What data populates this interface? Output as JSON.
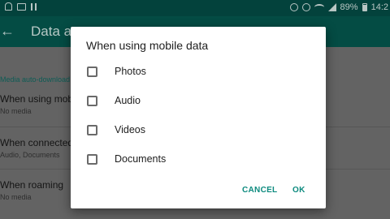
{
  "status_bar": {
    "battery_percent": "89%",
    "time": "14:2",
    "icons_left": [
      "notification-icon",
      "image-icon",
      "pause-icon"
    ],
    "icons_right": [
      "mute-icon",
      "alarm-icon",
      "wifi-icon",
      "signal-icon",
      "battery-icon"
    ]
  },
  "app_bar": {
    "title": "Data ar"
  },
  "background": {
    "section_label": "Media auto-download",
    "settings": [
      {
        "title": "When using mobile",
        "subtitle": "No media"
      },
      {
        "title": "When connected o",
        "subtitle": "Audio, Documents"
      },
      {
        "title": "When roaming",
        "subtitle": "No media"
      }
    ]
  },
  "dialog": {
    "title": "When using mobile data",
    "options": [
      {
        "label": "Photos",
        "checked": false
      },
      {
        "label": "Audio",
        "checked": false
      },
      {
        "label": "Videos",
        "checked": false
      },
      {
        "label": "Documents",
        "checked": false
      }
    ],
    "cancel_label": "CANCEL",
    "ok_label": "OK"
  },
  "colors": {
    "accent": "#0c8a7e",
    "app_bar": "#044c44",
    "status_bar": "#03423c"
  }
}
